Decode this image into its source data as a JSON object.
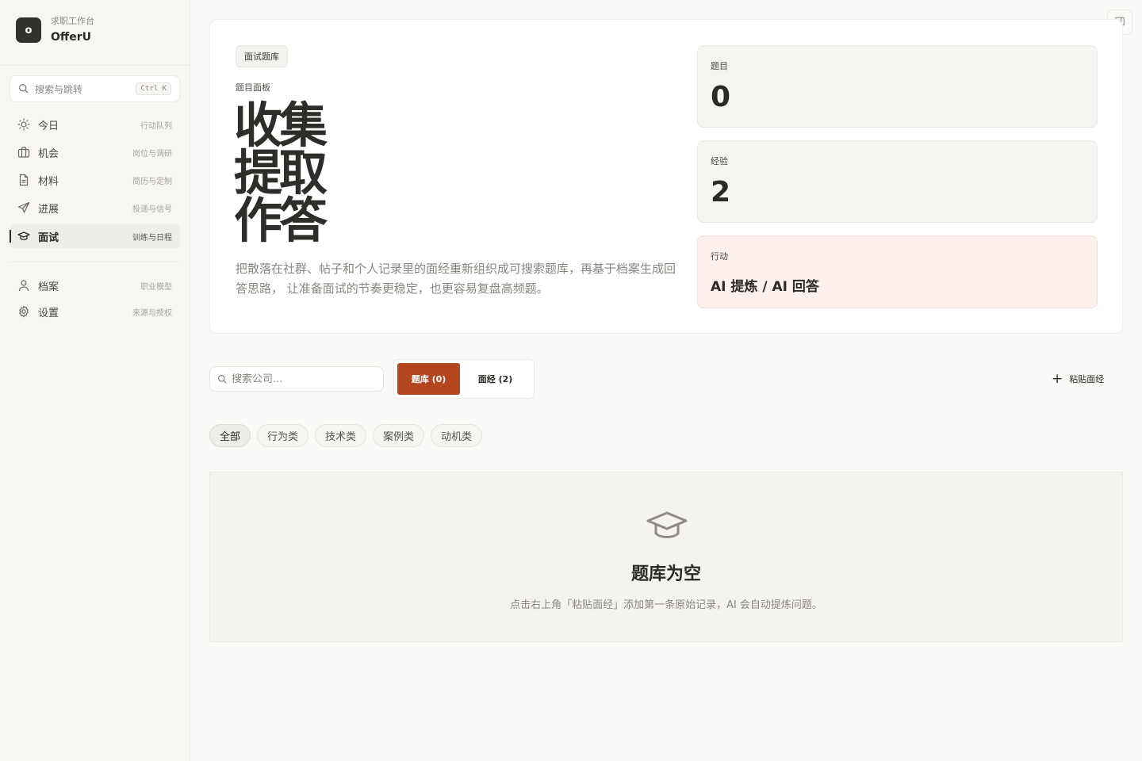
{
  "brand": {
    "logo": "o",
    "subtitle": "求职工作台",
    "title": "OfferU"
  },
  "search": {
    "placeholder": "搜索与跳转",
    "shortcut": "Ctrl K",
    "icon": "search-icon"
  },
  "nav": {
    "items": [
      {
        "label": "今日",
        "hint": "行动队列",
        "icon": "sun-icon"
      },
      {
        "label": "机会",
        "hint": "岗位与调研",
        "icon": "briefcase-icon"
      },
      {
        "label": "材料",
        "hint": "简历与定制",
        "icon": "document-icon"
      },
      {
        "label": "进展",
        "hint": "投递与信号",
        "icon": "send-icon"
      },
      {
        "label": "面试",
        "hint": "训练与日程",
        "icon": "graduation-cap-icon",
        "active": true
      }
    ],
    "secondary": [
      {
        "label": "档案",
        "hint": "职业模型",
        "icon": "user-icon"
      },
      {
        "label": "设置",
        "hint": "来源与授权",
        "icon": "gear-icon"
      }
    ]
  },
  "hero": {
    "tag": "面试题库",
    "kicker": "题目面板",
    "title": "收集提取作答",
    "description": "把散落在社群、帖子和个人记录里的面经重新组织成可搜索题库，再基于档案生成回答思路， 让准备面试的节奏更稳定，也更容易复盘高频题。",
    "stats": [
      {
        "label": "题目",
        "value": "0"
      },
      {
        "label": "经验",
        "value": "2"
      },
      {
        "label": "行动",
        "value": "AI 提炼 / AI 回答"
      }
    ]
  },
  "toolbar": {
    "company_search_placeholder": "搜索公司...",
    "tabs": [
      {
        "label": "题库 (0)",
        "active": true
      },
      {
        "label": "面经 (2)",
        "active": false
      }
    ],
    "paste_label": "粘贴面经"
  },
  "filters": [
    "全部",
    "行为类",
    "技术类",
    "案例类",
    "动机类"
  ],
  "empty": {
    "icon": "graduation-cap-icon",
    "title": "题库为空",
    "description": "点击右上角「粘贴面经」添加第一条原始记录，AI 会自动提炼问题。"
  },
  "colors": {
    "accent": "#b4461f",
    "warm_card": "#fbf0ec",
    "logo_bg": "#33322e"
  }
}
